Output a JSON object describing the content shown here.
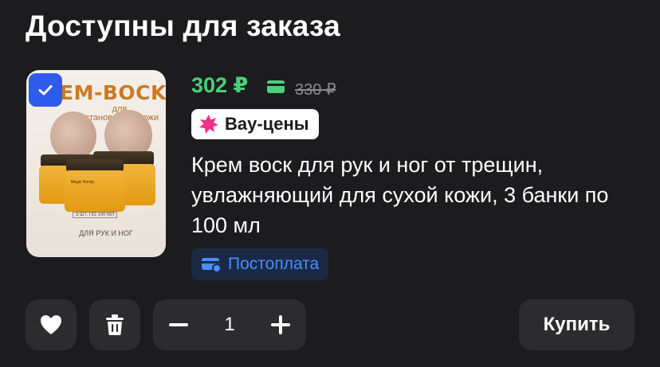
{
  "section": {
    "title": "Доступны для заказа"
  },
  "product": {
    "checked": true,
    "image": {
      "title": "EM-BOCK",
      "subtitle": "для\nсстановления кожи",
      "badge": "3 ШТ. ПО 100 МЛ",
      "caption": "ДЛЯ РУК И НОГ",
      "jar_text": "Magic Honey"
    },
    "price": "302 ₽",
    "old_price": "330 ₽",
    "wow_badge": "Вау-цены",
    "description": "Крем воск для рук и ног от трещин, увлажняющий для сухой кожи, 3 банки по 100 мл",
    "postpay": "Постоплата",
    "quantity": "1"
  },
  "actions": {
    "buy_label": "Купить"
  },
  "colors": {
    "price_green": "#4ad07a",
    "accent_blue": "#2f5bea",
    "postpay_blue": "#4b8cff",
    "wow_pink": "#f0308a",
    "background": "#1c1c1e",
    "button_bg": "#2c2c2e"
  },
  "icons": [
    "check-icon",
    "wallet-icon",
    "star-burst-icon",
    "card-icon",
    "heart-icon",
    "trash-icon",
    "minus-icon",
    "plus-icon"
  ]
}
